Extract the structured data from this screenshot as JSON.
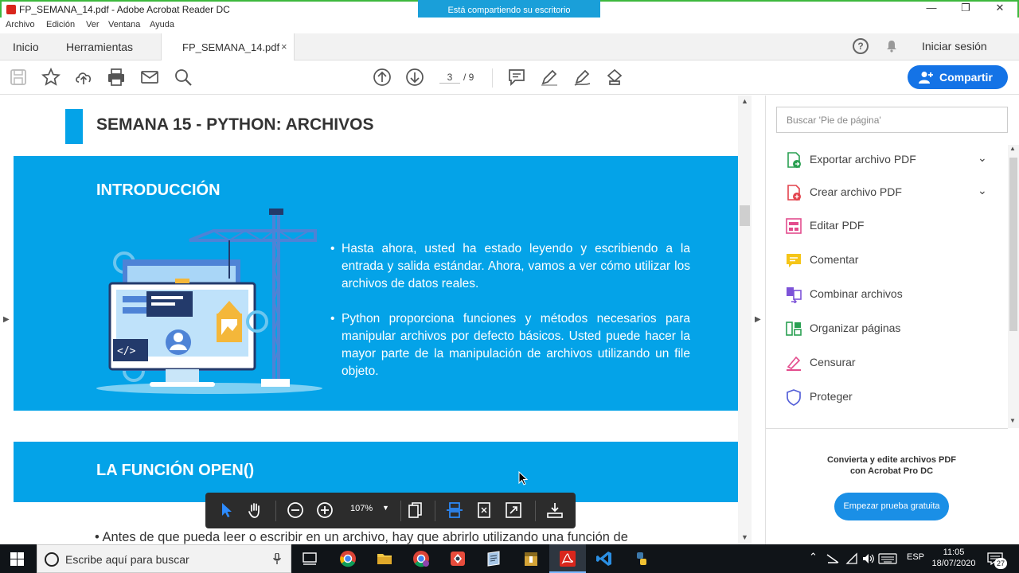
{
  "window": {
    "title": "FP_SEMANA_14.pdf - Adobe Acrobat Reader DC",
    "sharing_banner": "Está compartiendo su escritorio",
    "controls": [
      "minimize",
      "restore",
      "close"
    ]
  },
  "menu": [
    "Archivo",
    "Edición",
    "Ver",
    "Ventana",
    "Ayuda"
  ],
  "tabs": {
    "home": "Inicio",
    "tools": "Herramientas",
    "document": "FP_SEMANA_14.pdf",
    "close_glyph": "×"
  },
  "header_right": {
    "help": "?",
    "signin": "Iniciar sesión"
  },
  "toolbar": {
    "page_current": "3",
    "page_total": "/ 9",
    "share": "Compartir",
    "icons": [
      "save-icon",
      "star-icon",
      "upload-icon",
      "print-icon",
      "mail-icon",
      "zoom-icon",
      "page-up-icon",
      "page-down-icon",
      "comment-icon",
      "pen-icon",
      "sign-icon",
      "stamp-icon"
    ]
  },
  "document": {
    "title": "SEMANA 15 - PYTHON: ARCHIVOS",
    "intro_heading": "INTRODUCCIÓN",
    "bullets": [
      "Hasta ahora, usted ha estado leyendo y escribiendo a la entrada y salida estándar. Ahora, vamos a ver cómo utilizar los archivos de datos reales.",
      "Python proporciona funciones y métodos necesarios para manipular archivos por defecto básicos. Usted puede hacer la mayor parte de la manipulación de archivos utilizando un file objeto."
    ],
    "open_heading": "LA FUNCIÓN OPEN()",
    "bottom_text": "• Antes de que pueda leer o escribir en un archivo, hay que abrirlo utilizando una función de",
    "accent_color": "#04a3e8"
  },
  "float_toolbar": {
    "zoom": "107%"
  },
  "right_panel": {
    "search_placeholder": "Buscar 'Pie de página'",
    "tools": [
      {
        "label": "Exportar archivo PDF",
        "icon": "export-pdf-icon",
        "expandable": true
      },
      {
        "label": "Crear archivo PDF",
        "icon": "create-pdf-icon",
        "expandable": true
      },
      {
        "label": "Editar PDF",
        "icon": "edit-pdf-icon",
        "expandable": false
      },
      {
        "label": "Comentar",
        "icon": "comment-icon",
        "expandable": false
      },
      {
        "label": "Combinar archivos",
        "icon": "combine-icon",
        "expandable": false
      },
      {
        "label": "Organizar páginas",
        "icon": "organize-icon",
        "expandable": false
      },
      {
        "label": "Censurar",
        "icon": "redact-icon",
        "expandable": false
      },
      {
        "label": "Proteger",
        "icon": "shield-icon",
        "expandable": false
      }
    ],
    "promo_line1": "Convierta y edite archivos PDF",
    "promo_line2": "con Acrobat Pro DC",
    "trial_button": "Empezar prueba gratuita"
  },
  "taskbar": {
    "search_placeholder": "Escribe aquí para buscar",
    "language": "ESP",
    "time": "11:05",
    "date": "18/07/2020",
    "notifications": "27"
  }
}
